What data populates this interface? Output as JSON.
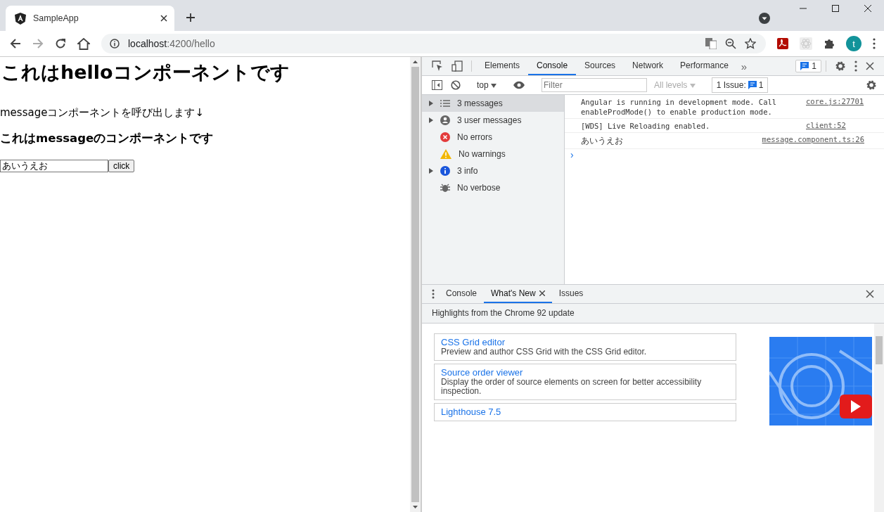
{
  "browser": {
    "tab_title": "SampleApp",
    "url_host": "localhost",
    "url_rest": ":4200/hello",
    "avatar": "t"
  },
  "page": {
    "heading": "これはhelloコンポーネントです",
    "text": "messageコンポーネントを呼び出します↓",
    "subheading": "これはmessageのコンポーネントです",
    "input_value": "あいうえお",
    "button": "click"
  },
  "devtools": {
    "tabs": [
      {
        "label": "Elements",
        "selected": false
      },
      {
        "label": "Console",
        "selected": true
      },
      {
        "label": "Sources",
        "selected": false
      },
      {
        "label": "Network",
        "selected": false
      },
      {
        "label": "Performance",
        "selected": false
      }
    ],
    "overflow": "»",
    "issues_badge": "1",
    "console_toolbar": {
      "context": "top",
      "filter_placeholder": "Filter",
      "levels": "All levels",
      "issues_label": "1 Issue:",
      "issues_count": "1"
    },
    "sidebar": [
      {
        "label": "3 messages",
        "kind": "list",
        "expandable": true,
        "selected": true
      },
      {
        "label": "3 user messages",
        "kind": "user",
        "expandable": true,
        "selected": false
      },
      {
        "label": "No errors",
        "kind": "error",
        "expandable": false,
        "selected": false
      },
      {
        "label": "No warnings",
        "kind": "warning",
        "expandable": false,
        "selected": false
      },
      {
        "label": "3 info",
        "kind": "info",
        "expandable": true,
        "selected": false
      },
      {
        "label": "No verbose",
        "kind": "verbose",
        "expandable": false,
        "selected": false
      }
    ],
    "messages": [
      {
        "text": "Angular is running in development mode. Call enableProdMode() to enable production mode.",
        "source": "core.js:27701",
        "kind": "code"
      },
      {
        "text": "[WDS] Live Reloading enabled.",
        "source": "client:52",
        "kind": "code"
      },
      {
        "text": "あいうえお",
        "source": "message.component.ts:26",
        "kind": "plain"
      }
    ],
    "prompt": "›",
    "drawer": {
      "tabs": [
        {
          "label": "Console",
          "selected": false,
          "closable": false
        },
        {
          "label": "What's New",
          "selected": true,
          "closable": true
        },
        {
          "label": "Issues",
          "selected": false,
          "closable": false
        }
      ],
      "header": "Highlights from the Chrome 92 update",
      "cards": [
        {
          "title": "CSS Grid editor",
          "description": "Preview and author CSS Grid with the CSS Grid editor."
        },
        {
          "title": "Source order viewer",
          "description": "Display the order of source elements on screen for better accessibility inspection."
        },
        {
          "title": "Lighthouse 7.5"
        }
      ]
    }
  }
}
